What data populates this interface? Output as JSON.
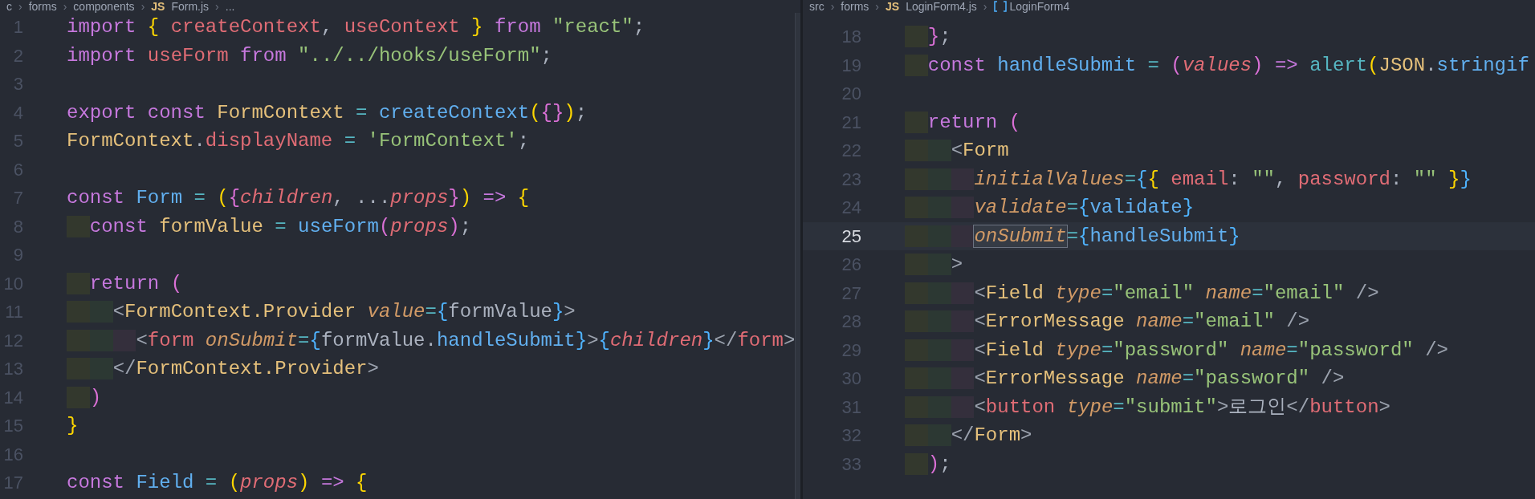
{
  "panes": [
    {
      "breadcrumbs": [
        {
          "kind": "folder",
          "label": "c"
        },
        {
          "kind": "folder",
          "label": "forms"
        },
        {
          "kind": "folder",
          "label": "components"
        },
        {
          "kind": "file",
          "badge": "JS",
          "label": "Form.js"
        },
        {
          "kind": "more",
          "label": "..."
        }
      ],
      "separator": "›",
      "lines": [
        {
          "number": "1",
          "current": false,
          "tokens": [
            {
              "kind": "kw",
              "text": "import "
            },
            {
              "kind": "brace",
              "text": "{ "
            },
            {
              "kind": "var",
              "text": "createContext"
            },
            {
              "kind": "punc",
              "text": ", "
            },
            {
              "kind": "var",
              "text": "useContext"
            },
            {
              "kind": "brace",
              "text": " }"
            },
            {
              "kind": "kw",
              "text": " from "
            },
            {
              "kind": "str",
              "text": "\"react\""
            },
            {
              "kind": "punc",
              "text": ";"
            }
          ]
        },
        {
          "number": "2",
          "current": false,
          "tokens": [
            {
              "kind": "kw",
              "text": "import "
            },
            {
              "kind": "var",
              "text": "useForm"
            },
            {
              "kind": "kw",
              "text": " from "
            },
            {
              "kind": "str",
              "text": "\"../../hooks/useForm\""
            },
            {
              "kind": "punc",
              "text": ";"
            }
          ]
        },
        {
          "number": "3",
          "current": false
        },
        {
          "number": "4",
          "current": false,
          "tokens": [
            {
              "kind": "kw",
              "text": "export const "
            },
            {
              "kind": "cls",
              "text": "FormContext"
            },
            {
              "kind": "op",
              "text": " = "
            },
            {
              "kind": "fn",
              "text": "createContext"
            },
            {
              "kind": "brace",
              "text": "("
            },
            {
              "kind": "pink",
              "text": "{}"
            },
            {
              "kind": "brace",
              "text": ")"
            },
            {
              "kind": "punc",
              "text": ";"
            }
          ]
        },
        {
          "number": "5",
          "current": false,
          "tokens": [
            {
              "kind": "cls",
              "text": "FormContext"
            },
            {
              "kind": "punc",
              "text": "."
            },
            {
              "kind": "var",
              "text": "displayName"
            },
            {
              "kind": "op",
              "text": " = "
            },
            {
              "kind": "str",
              "text": "'FormContext'"
            },
            {
              "kind": "punc",
              "text": ";"
            }
          ]
        },
        {
          "number": "6",
          "current": false
        },
        {
          "number": "7",
          "current": false,
          "tokens": [
            {
              "kind": "kw",
              "text": "const "
            },
            {
              "kind": "fn",
              "text": "Form"
            },
            {
              "kind": "op",
              "text": " = "
            },
            {
              "kind": "brace",
              "text": "("
            },
            {
              "kind": "pink",
              "text": "{"
            },
            {
              "kind": "param",
              "text": "children"
            },
            {
              "kind": "punc",
              "text": ", ..."
            },
            {
              "kind": "param",
              "text": "props"
            },
            {
              "kind": "pink",
              "text": "}"
            },
            {
              "kind": "brace",
              "text": ")"
            },
            {
              "kind": "kw",
              "text": " => "
            },
            {
              "kind": "brace",
              "text": "{"
            }
          ]
        },
        {
          "number": "8",
          "current": false,
          "tokens": [
            {
              "kind": "kw",
              "text": "  const "
            },
            {
              "kind": "cls",
              "text": "formValue"
            },
            {
              "kind": "op",
              "text": " = "
            },
            {
              "kind": "fn",
              "text": "useForm"
            },
            {
              "kind": "pink",
              "text": "("
            },
            {
              "kind": "param",
              "text": "props"
            },
            {
              "kind": "pink",
              "text": ")"
            },
            {
              "kind": "punc",
              "text": ";"
            }
          ]
        },
        {
          "number": "9",
          "current": false
        },
        {
          "number": "10",
          "current": false,
          "tokens": [
            {
              "kind": "kw",
              "text": "  return "
            },
            {
              "kind": "pink",
              "text": "("
            }
          ]
        },
        {
          "number": "11",
          "current": false,
          "tokens": [
            {
              "kind": "tag",
              "text": "    <"
            },
            {
              "kind": "cls",
              "text": "FormContext.Provider"
            },
            {
              "kind": "attr",
              "text": " value"
            },
            {
              "kind": "op",
              "text": "="
            },
            {
              "kind": "blue",
              "text": "{"
            },
            {
              "kind": "plain",
              "text": "formValue"
            },
            {
              "kind": "blue",
              "text": "}"
            },
            {
              "kind": "tag",
              "text": ">"
            }
          ]
        },
        {
          "number": "12",
          "current": false,
          "tokens": [
            {
              "kind": "tag",
              "text": "      <"
            },
            {
              "kind": "var",
              "text": "form"
            },
            {
              "kind": "attr",
              "text": " onSubmit"
            },
            {
              "kind": "op",
              "text": "="
            },
            {
              "kind": "blue",
              "text": "{"
            },
            {
              "kind": "plain",
              "text": "formValue."
            },
            {
              "kind": "fn",
              "text": "handleSubmit"
            },
            {
              "kind": "blue",
              "text": "}"
            },
            {
              "kind": "tag",
              "text": ">"
            },
            {
              "kind": "blue",
              "text": "{"
            },
            {
              "kind": "param",
              "text": "children"
            },
            {
              "kind": "blue",
              "text": "}"
            },
            {
              "kind": "tag",
              "text": "</"
            },
            {
              "kind": "var",
              "text": "form"
            },
            {
              "kind": "tag",
              "text": ">"
            }
          ]
        },
        {
          "number": "13",
          "current": false,
          "tokens": [
            {
              "kind": "tag",
              "text": "    </"
            },
            {
              "kind": "cls",
              "text": "FormContext.Provider"
            },
            {
              "kind": "tag",
              "text": ">"
            }
          ]
        },
        {
          "number": "14",
          "current": false,
          "tokens": [
            {
              "kind": "pink",
              "text": "  )"
            }
          ]
        },
        {
          "number": "15",
          "current": false,
          "tokens": [
            {
              "kind": "brace",
              "text": "}"
            }
          ]
        },
        {
          "number": "16",
          "current": false
        },
        {
          "number": "17",
          "current": false,
          "tokens": [
            {
              "kind": "kw",
              "text": "const "
            },
            {
              "kind": "fn",
              "text": "Field"
            },
            {
              "kind": "op",
              "text": " = "
            },
            {
              "kind": "brace",
              "text": "("
            },
            {
              "kind": "param",
              "text": "props"
            },
            {
              "kind": "brace",
              "text": ")"
            },
            {
              "kind": "kw",
              "text": " => "
            },
            {
              "kind": "brace",
              "text": "{"
            }
          ]
        }
      ]
    },
    {
      "breadcrumbs": [
        {
          "kind": "folder",
          "label": "src"
        },
        {
          "kind": "folder",
          "label": "forms"
        },
        {
          "kind": "file",
          "badge": "JS",
          "label": "LoginForm4.js"
        },
        {
          "kind": "symbol",
          "label": "LoginForm4"
        }
      ],
      "separator": "›",
      "lines": [
        {
          "number": "18",
          "current": false,
          "tokens": [
            {
              "kind": "pink",
              "text": "  }"
            },
            {
              "kind": "punc",
              "text": ";"
            }
          ]
        },
        {
          "number": "19",
          "current": false,
          "tokens": [
            {
              "kind": "kw",
              "text": "  const "
            },
            {
              "kind": "fn",
              "text": "handleSubmit"
            },
            {
              "kind": "op",
              "text": " = "
            },
            {
              "kind": "pink",
              "text": "("
            },
            {
              "kind": "param",
              "text": "values"
            },
            {
              "kind": "pink",
              "text": ")"
            },
            {
              "kind": "kw",
              "text": " => "
            },
            {
              "kind": "op",
              "text": "alert"
            },
            {
              "kind": "brace",
              "text": "("
            },
            {
              "kind": "cls",
              "text": "JSON"
            },
            {
              "kind": "punc",
              "text": "."
            },
            {
              "kind": "fn",
              "text": "stringif"
            }
          ]
        },
        {
          "number": "20",
          "current": false
        },
        {
          "number": "21",
          "current": false,
          "tokens": [
            {
              "kind": "kw",
              "text": "  return "
            },
            {
              "kind": "pink",
              "text": "("
            }
          ]
        },
        {
          "number": "22",
          "current": false,
          "tokens": [
            {
              "kind": "tag",
              "text": "    <"
            },
            {
              "kind": "cls",
              "text": "Form"
            }
          ]
        },
        {
          "number": "23",
          "current": false,
          "tokens": [
            {
              "kind": "attr",
              "text": "      initialValues"
            },
            {
              "kind": "op",
              "text": "="
            },
            {
              "kind": "blue",
              "text": "{"
            },
            {
              "kind": "brace",
              "text": "{"
            },
            {
              "kind": "var",
              "text": " email"
            },
            {
              "kind": "punc",
              "text": ": "
            },
            {
              "kind": "str",
              "text": "\"\""
            },
            {
              "kind": "punc",
              "text": ", "
            },
            {
              "kind": "var",
              "text": "password"
            },
            {
              "kind": "punc",
              "text": ": "
            },
            {
              "kind": "str",
              "text": "\"\" "
            },
            {
              "kind": "brace",
              "text": "}"
            },
            {
              "kind": "blue",
              "text": "}"
            }
          ]
        },
        {
          "number": "24",
          "current": false,
          "tokens": [
            {
              "kind": "attr",
              "text": "      validate"
            },
            {
              "kind": "op",
              "text": "="
            },
            {
              "kind": "blue",
              "text": "{"
            },
            {
              "kind": "fn",
              "text": "validate"
            },
            {
              "kind": "blue",
              "text": "}"
            }
          ]
        },
        {
          "number": "25",
          "current": true,
          "tokens": [
            {
              "kind": "mark",
              "text": "      onSubmit"
            },
            {
              "kind": "op",
              "text": "="
            },
            {
              "kind": "blue",
              "text": "{"
            },
            {
              "kind": "fn",
              "text": "handleSubmit"
            },
            {
              "kind": "blue",
              "text": "}"
            }
          ]
        },
        {
          "number": "26",
          "current": false,
          "tokens": [
            {
              "kind": "tag",
              "text": "    >"
            }
          ]
        },
        {
          "number": "27",
          "current": false,
          "tokens": [
            {
              "kind": "tag",
              "text": "      <"
            },
            {
              "kind": "cls",
              "text": "Field"
            },
            {
              "kind": "attr",
              "text": " type"
            },
            {
              "kind": "op",
              "text": "="
            },
            {
              "kind": "str",
              "text": "\"email\""
            },
            {
              "kind": "attr",
              "text": " name"
            },
            {
              "kind": "op",
              "text": "="
            },
            {
              "kind": "str",
              "text": "\"email\""
            },
            {
              "kind": "tag",
              "text": " />"
            }
          ]
        },
        {
          "number": "28",
          "current": false,
          "tokens": [
            {
              "kind": "tag",
              "text": "      <"
            },
            {
              "kind": "cls",
              "text": "ErrorMessage"
            },
            {
              "kind": "attr",
              "text": " name"
            },
            {
              "kind": "op",
              "text": "="
            },
            {
              "kind": "str",
              "text": "\"email\""
            },
            {
              "kind": "tag",
              "text": " />"
            }
          ]
        },
        {
          "number": "29",
          "current": false,
          "tokens": [
            {
              "kind": "tag",
              "text": "      <"
            },
            {
              "kind": "cls",
              "text": "Field"
            },
            {
              "kind": "attr",
              "text": " type"
            },
            {
              "kind": "op",
              "text": "="
            },
            {
              "kind": "str",
              "text": "\"password\""
            },
            {
              "kind": "attr",
              "text": " name"
            },
            {
              "kind": "op",
              "text": "="
            },
            {
              "kind": "str",
              "text": "\"password\""
            },
            {
              "kind": "tag",
              "text": " />"
            }
          ]
        },
        {
          "number": "30",
          "current": false,
          "tokens": [
            {
              "kind": "tag",
              "text": "      <"
            },
            {
              "kind": "cls",
              "text": "ErrorMessage"
            },
            {
              "kind": "attr",
              "text": " name"
            },
            {
              "kind": "op",
              "text": "="
            },
            {
              "kind": "str",
              "text": "\"password\""
            },
            {
              "kind": "tag",
              "text": " />"
            }
          ]
        },
        {
          "number": "31",
          "current": false,
          "tokens": [
            {
              "kind": "tag",
              "text": "      <"
            },
            {
              "kind": "var",
              "text": "button"
            },
            {
              "kind": "attr",
              "text": " type"
            },
            {
              "kind": "op",
              "text": "="
            },
            {
              "kind": "str",
              "text": "\"submit\""
            },
            {
              "kind": "tag",
              "text": ">"
            },
            {
              "kind": "plain",
              "text": "로그인"
            },
            {
              "kind": "tag",
              "text": "</"
            },
            {
              "kind": "var",
              "text": "button"
            },
            {
              "kind": "tag",
              "text": ">"
            }
          ]
        },
        {
          "number": "32",
          "current": false,
          "tokens": [
            {
              "kind": "tag",
              "text": "    </"
            },
            {
              "kind": "cls",
              "text": "Form"
            },
            {
              "kind": "tag",
              "text": ">"
            }
          ]
        },
        {
          "number": "33",
          "current": false,
          "tokens": [
            {
              "kind": "pink",
              "text": "  )"
            },
            {
              "kind": "punc",
              "text": ";"
            }
          ]
        }
      ]
    }
  ]
}
